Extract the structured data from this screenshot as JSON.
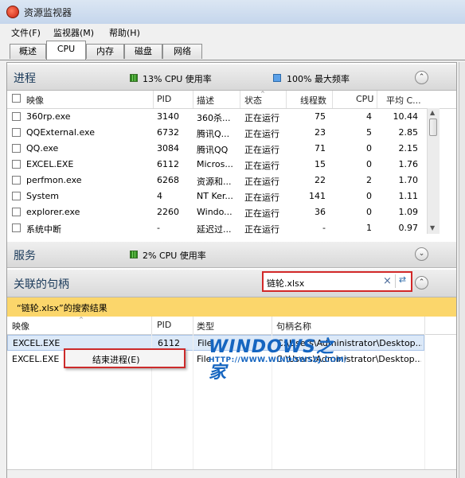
{
  "window": {
    "title": "资源监视器"
  },
  "menu": [
    "文件(F)",
    "监视器(M)",
    "帮助(H)"
  ],
  "tabs": [
    "概述",
    "CPU",
    "内存",
    "磁盘",
    "网络"
  ],
  "active_tab": "CPU",
  "processes": {
    "title": "进程",
    "cpu_usage": "13% CPU 使用率",
    "max_freq": "100% 最大频率",
    "columns": [
      "映像",
      "PID",
      "描述",
      "状态",
      "线程数",
      "CPU",
      "平均 C..."
    ],
    "rows": [
      {
        "image": "360rp.exe",
        "pid": "3140",
        "desc": "360杀...",
        "status": "正在运行",
        "threads": "75",
        "cpu": "4",
        "avg": "10.44"
      },
      {
        "image": "QQExternal.exe",
        "pid": "6732",
        "desc": "腾讯Q...",
        "status": "正在运行",
        "threads": "23",
        "cpu": "5",
        "avg": "2.85"
      },
      {
        "image": "QQ.exe",
        "pid": "3084",
        "desc": "腾讯QQ",
        "status": "正在运行",
        "threads": "71",
        "cpu": "0",
        "avg": "2.15"
      },
      {
        "image": "EXCEL.EXE",
        "pid": "6112",
        "desc": "Micros...",
        "status": "正在运行",
        "threads": "15",
        "cpu": "0",
        "avg": "1.76"
      },
      {
        "image": "perfmon.exe",
        "pid": "6268",
        "desc": "资源和...",
        "status": "正在运行",
        "threads": "22",
        "cpu": "2",
        "avg": "1.70"
      },
      {
        "image": "System",
        "pid": "4",
        "desc": "NT Ker...",
        "status": "正在运行",
        "threads": "141",
        "cpu": "0",
        "avg": "1.11"
      },
      {
        "image": "explorer.exe",
        "pid": "2260",
        "desc": "Windo...",
        "status": "正在运行",
        "threads": "36",
        "cpu": "0",
        "avg": "1.09"
      },
      {
        "image": "系统中断",
        "pid": "-",
        "desc": "延迟过...",
        "status": "正在运行",
        "threads": "-",
        "cpu": "1",
        "avg": "0.97"
      }
    ]
  },
  "services": {
    "title": "服务",
    "cpu_usage": "2% CPU 使用率"
  },
  "handles": {
    "title": "关联的句柄",
    "search_value": "链轮.xlsx",
    "result_text": "“链轮.xlsx”的搜索结果",
    "columns": [
      "映像",
      "PID",
      "类型",
      "句柄名称"
    ],
    "rows": [
      {
        "image": "EXCEL.EXE",
        "pid": "6112",
        "type": "File",
        "name": "C:\\Users\\Administrator\\Desktop..."
      },
      {
        "image": "EXCEL.EXE",
        "pid": "",
        "type": "File",
        "name": "C:\\Users\\Administrator\\Desktop..."
      }
    ]
  },
  "context_menu": {
    "item": "结束进程(E)"
  },
  "watermark": {
    "title": "WINDOWS之家",
    "url": "HTTP://WWW.WINDOWSZJ.COM/"
  },
  "colors": {
    "accent_red": "#d22828",
    "result_bar": "#fbd66b",
    "selection": "#dce9f8",
    "legend_green": "#2f8a1f",
    "legend_blue": "#5aa0e8"
  }
}
